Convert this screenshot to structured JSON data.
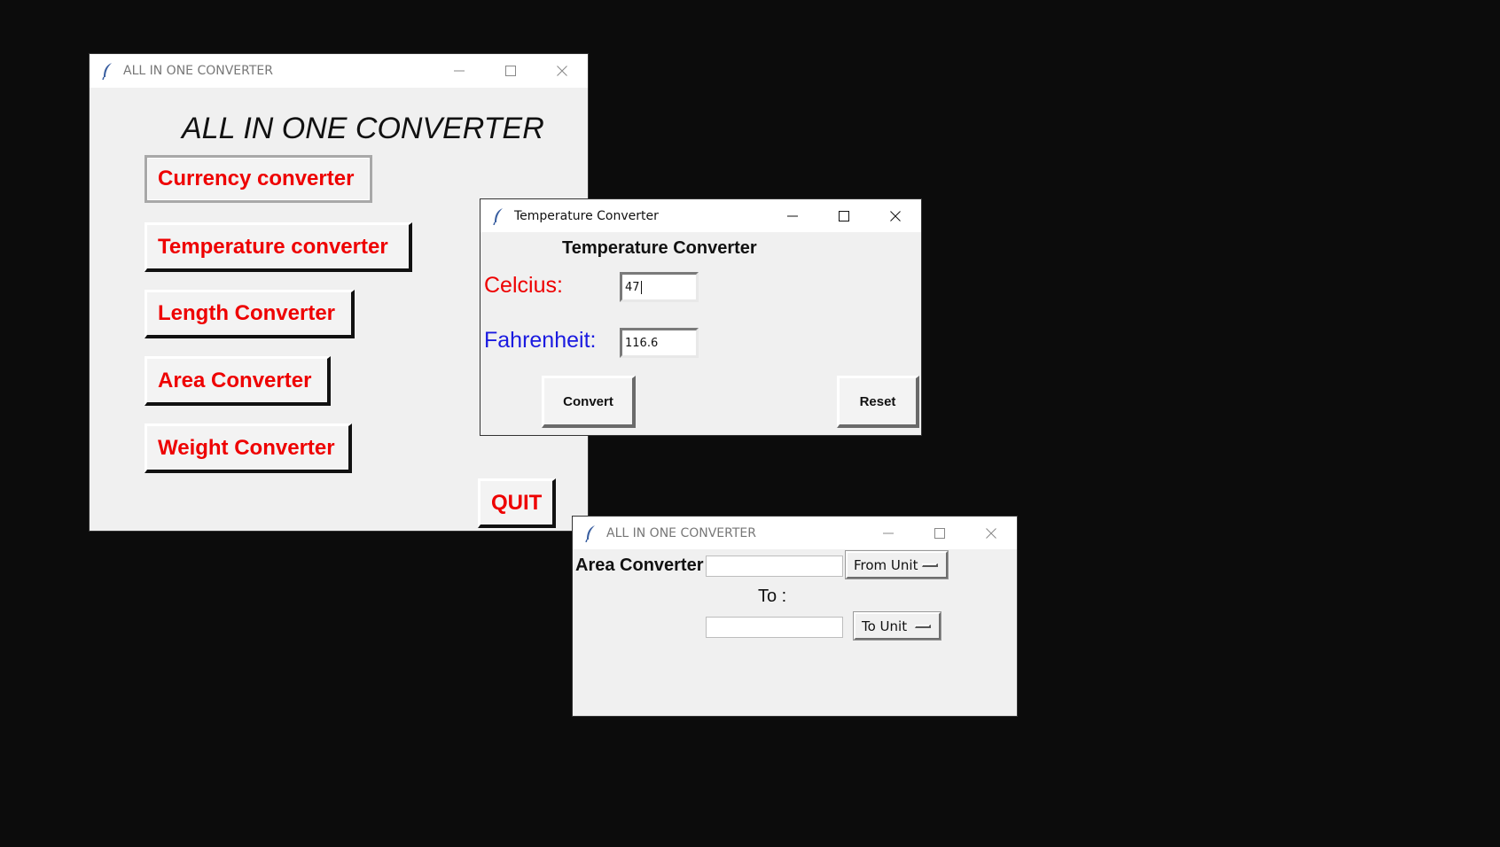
{
  "main_window": {
    "title": "ALL IN ONE CONVERTER",
    "heading": "ALL IN ONE CONVERTER",
    "buttons": {
      "currency": "Currency converter",
      "temperature": "Temperature converter",
      "length": "Length Converter",
      "area": "Area Converter",
      "weight": "Weight Converter",
      "quit": "QUIT"
    }
  },
  "temp_window": {
    "title": "Temperature Converter",
    "heading": "Temperature Converter",
    "celcius_label": "Celcius:",
    "fahrenheit_label": "Fahrenheit:",
    "celcius_value": "47",
    "fahrenheit_value": "116.6",
    "convert_label": "Convert",
    "reset_label": "Reset"
  },
  "area_window": {
    "title": "ALL IN ONE CONVERTER",
    "label": "Area Converter",
    "input_value": "",
    "from_unit": "From Unit",
    "to_label": "To :",
    "output_value": "",
    "to_unit": "To Unit"
  },
  "colors": {
    "desktop_bg": "#0c0c0c",
    "window_bg": "#f0f0f0",
    "button_text_red": "#ee0000",
    "celcius_red": "#ee0000",
    "fahrenheit_blue": "#1a1ae0"
  },
  "icons": [
    "feather-icon",
    "minimize-icon",
    "maximize-icon",
    "close-icon"
  ]
}
